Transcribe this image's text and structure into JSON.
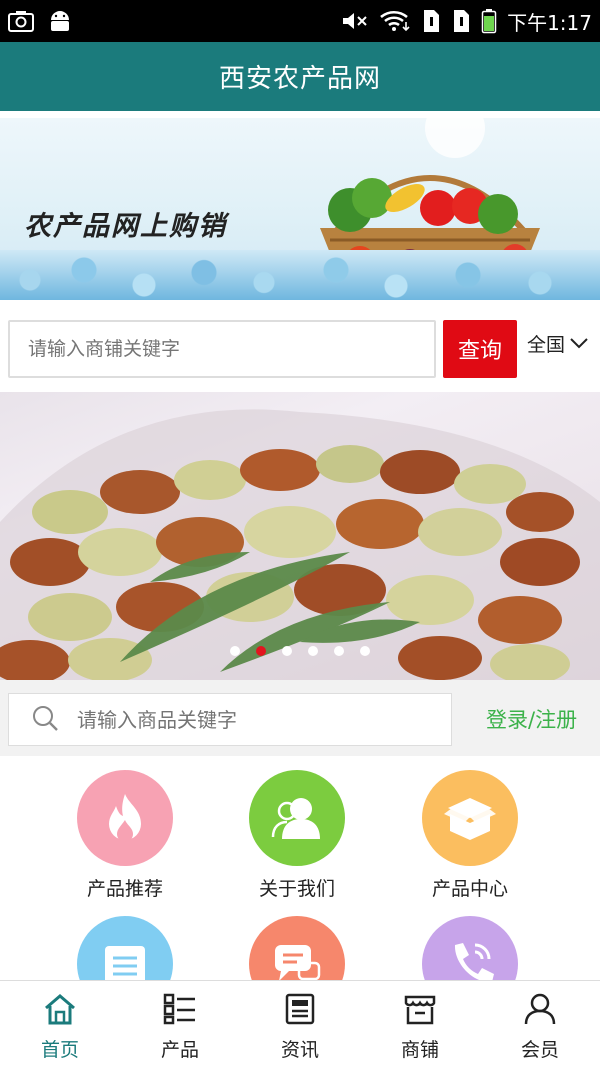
{
  "status_bar": {
    "time": "下午1:17",
    "icons": [
      "screenshot-icon",
      "android-icon",
      "mute-icon",
      "wifi-icon",
      "sim1-icon",
      "sim2-icon",
      "battery-icon"
    ]
  },
  "app": {
    "title": "西安农产品网"
  },
  "banner": {
    "headline": "农产品网上购销"
  },
  "shop_search": {
    "placeholder": "请输入商铺关键字",
    "button_label": "查询",
    "region": "全国"
  },
  "slider": {
    "dot_count": 6,
    "active_index": 1
  },
  "product_search": {
    "placeholder": "请输入商品关键字",
    "login_label": "登录/注册"
  },
  "grid": {
    "items": [
      {
        "label": "产品推荐",
        "icon": "fire-icon",
        "color": "#f7a2b3"
      },
      {
        "label": "关于我们",
        "icon": "users-icon",
        "color": "#7ccc3f"
      },
      {
        "label": "产品中心",
        "icon": "box-icon",
        "color": "#fbbe5f"
      },
      {
        "label": "",
        "icon": "list-icon",
        "color": "#80cdf2"
      },
      {
        "label": "",
        "icon": "chat-icon",
        "color": "#f6876c"
      },
      {
        "label": "",
        "icon": "phone-icon",
        "color": "#c7a4ea"
      }
    ]
  },
  "tabs": [
    {
      "label": "首页",
      "icon": "home-icon",
      "active": true
    },
    {
      "label": "产品",
      "icon": "grid-list-icon",
      "active": false
    },
    {
      "label": "资讯",
      "icon": "news-icon",
      "active": false
    },
    {
      "label": "商铺",
      "icon": "store-icon",
      "active": false
    },
    {
      "label": "会员",
      "icon": "user-icon",
      "active": false
    }
  ],
  "colors": {
    "brand": "#1b7b7c",
    "search_button": "#e00a14",
    "login_link": "#3cb24a",
    "active_dot": "#e3151f"
  }
}
